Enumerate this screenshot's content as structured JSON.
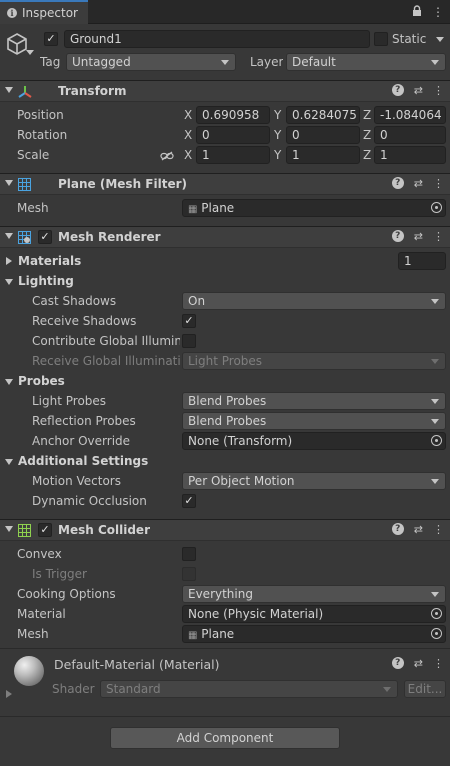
{
  "tab": {
    "title": "Inspector"
  },
  "object": {
    "name": "Ground1",
    "static_label": "Static",
    "tag_label": "Tag",
    "tag_value": "Untagged",
    "layer_label": "Layer",
    "layer_value": "Default"
  },
  "transform": {
    "title": "Transform",
    "position_label": "Position",
    "rotation_label": "Rotation",
    "scale_label": "Scale",
    "x": "X",
    "y": "Y",
    "z": "Z",
    "position": [
      "0.690958",
      "0.6284075",
      "-1.084064"
    ],
    "rotation": [
      "0",
      "0",
      "0"
    ],
    "scale": [
      "1",
      "1",
      "1"
    ]
  },
  "mesh_filter": {
    "title": "Plane (Mesh Filter)",
    "mesh_label": "Mesh",
    "mesh_value": "Plane"
  },
  "mesh_renderer": {
    "title": "Mesh Renderer",
    "materials_label": "Materials",
    "materials_count": "1",
    "lighting_label": "Lighting",
    "cast_shadows_label": "Cast Shadows",
    "cast_shadows_value": "On",
    "receive_shadows_label": "Receive Shadows",
    "contribute_gi_label": "Contribute Global Illuminat",
    "receive_gi_label": "Receive Global Illuminatior",
    "receive_gi_value": "Light Probes",
    "probes_label": "Probes",
    "light_probes_label": "Light Probes",
    "light_probes_value": "Blend Probes",
    "reflection_probes_label": "Reflection Probes",
    "reflection_probes_value": "Blend Probes",
    "anchor_override_label": "Anchor Override",
    "anchor_override_value": "None (Transform)",
    "additional_label": "Additional Settings",
    "motion_vectors_label": "Motion Vectors",
    "motion_vectors_value": "Per Object Motion",
    "dynamic_occlusion_label": "Dynamic Occlusion"
  },
  "mesh_collider": {
    "title": "Mesh Collider",
    "convex_label": "Convex",
    "is_trigger_label": "Is Trigger",
    "cooking_label": "Cooking Options",
    "cooking_value": "Everything",
    "material_label": "Material",
    "material_value": "None (Physic Material)",
    "mesh_label": "Mesh",
    "mesh_value": "Plane"
  },
  "material": {
    "title": "Default-Material (Material)",
    "shader_label": "Shader",
    "shader_value": "Standard",
    "edit_label": "Edit..."
  },
  "add_component_label": "Add Component",
  "colors": {
    "accent_tab": "#3a79bb",
    "background": "#383838",
    "header": "#3e3e3e",
    "field": "#2a2a2a"
  }
}
